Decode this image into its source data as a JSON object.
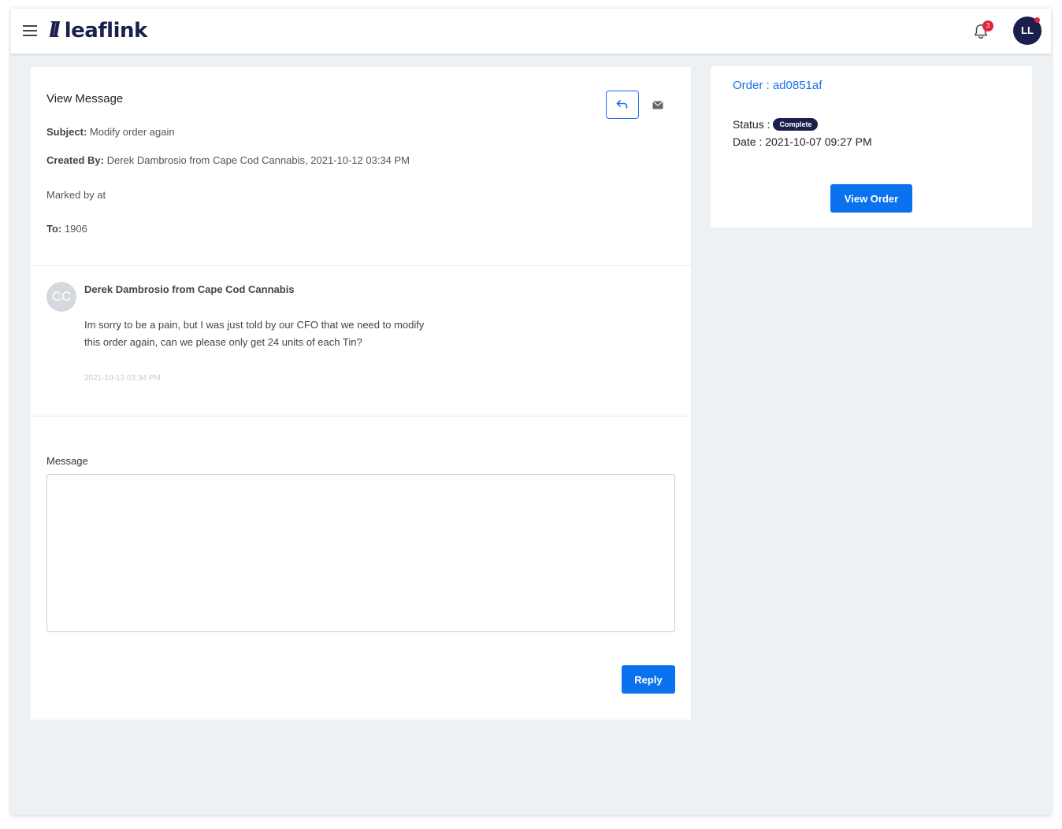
{
  "brand": {
    "logo_mark": "ll",
    "name": "leaflink",
    "accent": "#0a72ef",
    "navy": "#1a1f4b"
  },
  "header": {
    "notification_count": "3",
    "avatar_initials": "LL"
  },
  "message_view": {
    "title": "View Message",
    "subject_label": "Subject:",
    "subject_value": " Modify order again",
    "created_by_label": "Created By:",
    "created_by_value": " Derek Dambrosio from Cape Cod Cannabis, 2021-10-12 03:34 PM",
    "marked_by": "Marked by at",
    "to_label": "To:",
    "to_value": " 1906"
  },
  "thread": {
    "avatar_initials": "CC",
    "author": "Derek Dambrosio from Cape Cod Cannabis",
    "body": "Im sorry to be a pain, but I was just told by our CFO that we need to modify this order again, can we please only get 24 units of each Tin?",
    "timestamp": "2021-10-12 03:34 PM"
  },
  "reply_form": {
    "label": "Message",
    "placeholder": "",
    "button": "Reply"
  },
  "order_card": {
    "order_link": "Order : ad0851af",
    "status_label": "Status :",
    "status_badge": "Complete",
    "date": "Date : 2021-10-07 09:27 PM",
    "view_button": "View Order"
  }
}
